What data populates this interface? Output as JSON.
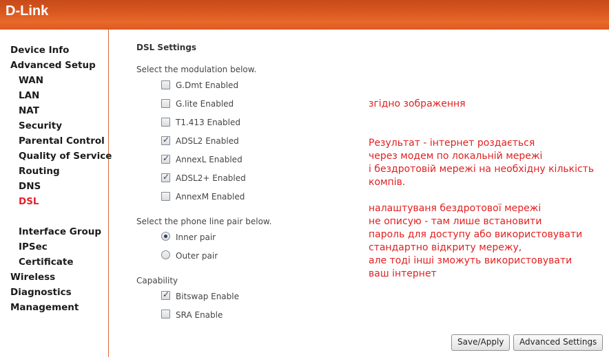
{
  "header": {
    "logo": "D-Link"
  },
  "sidebar": {
    "items": [
      {
        "label": "Device Info",
        "level": 0,
        "active": false
      },
      {
        "label": "Advanced Setup",
        "level": 0,
        "active": false
      },
      {
        "label": "WAN",
        "level": 1,
        "active": false
      },
      {
        "label": "LAN",
        "level": 1,
        "active": false
      },
      {
        "label": "NAT",
        "level": 1,
        "active": false
      },
      {
        "label": "Security",
        "level": 1,
        "active": false
      },
      {
        "label": "Parental Control",
        "level": 1,
        "active": false
      },
      {
        "label": "Quality of Service",
        "level": 1,
        "active": false
      },
      {
        "label": "Routing",
        "level": 1,
        "active": false
      },
      {
        "label": "DNS",
        "level": 1,
        "active": false
      },
      {
        "label": "DSL",
        "level": 1,
        "active": true
      },
      {
        "label": "Interface Group",
        "level": 1,
        "active": false
      },
      {
        "label": "IPSec",
        "level": 1,
        "active": false
      },
      {
        "label": "Certificate",
        "level": 1,
        "active": false
      },
      {
        "label": "Wireless",
        "level": 0,
        "active": false
      },
      {
        "label": "Diagnostics",
        "level": 0,
        "active": false
      },
      {
        "label": "Management",
        "level": 0,
        "active": false
      }
    ]
  },
  "main": {
    "title": "DSL Settings",
    "modulation_label": "Select the modulation below.",
    "modulations": [
      {
        "label": "G.Dmt Enabled",
        "checked": false
      },
      {
        "label": "G.lite Enabled",
        "checked": false
      },
      {
        "label": "T1.413 Enabled",
        "checked": false
      },
      {
        "label": "ADSL2 Enabled",
        "checked": true
      },
      {
        "label": "AnnexL Enabled",
        "checked": true
      },
      {
        "label": "ADSL2+ Enabled",
        "checked": true
      },
      {
        "label": "AnnexM Enabled",
        "checked": false
      }
    ],
    "phone_label": "Select the phone line pair below.",
    "phone_pairs": [
      {
        "label": "Inner pair",
        "selected": true
      },
      {
        "label": "Outer pair",
        "selected": false
      }
    ],
    "capability_label": "Capability",
    "capabilities": [
      {
        "label": "Bitswap Enable",
        "checked": true
      },
      {
        "label": "SRA Enable",
        "checked": false
      }
    ],
    "buttons": {
      "save": "Save/Apply",
      "advanced": "Advanced Settings"
    }
  },
  "annotation": {
    "line1": "згідно зображення",
    "block2": [
      "Результат - інтернет роздається",
      "через модем по локальній мережі",
      "і бездротовій мережі на необхідну кількість",
      "компів."
    ],
    "block3": [
      "налаштуваня бездротової мережі",
      "не описую - там лише встановити",
      "пароль для доступу або використовувати",
      "стандартно відкриту мережу,",
      "але тоді інші зможуть використовувати",
      "ваш інтернет"
    ]
  },
  "colors": {
    "header": "#dc5a22",
    "active_nav": "#e8202a",
    "annotation": "#e02020",
    "sidebar_border": "#d9682f"
  }
}
